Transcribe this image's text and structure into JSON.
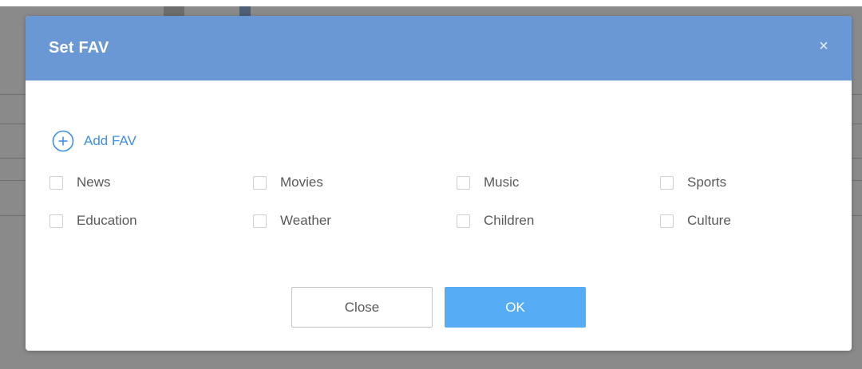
{
  "dialog": {
    "title": "Set FAV",
    "close_icon": "×",
    "accent_color": "#6a98d4"
  },
  "add_fav": {
    "icon": "plus-circle-icon",
    "label": "Add FAV",
    "color": "#3d8fe6"
  },
  "options": [
    {
      "label": "News",
      "checked": false
    },
    {
      "label": "Movies",
      "checked": false
    },
    {
      "label": "Music",
      "checked": false
    },
    {
      "label": "Sports",
      "checked": false
    },
    {
      "label": "Education",
      "checked": false
    },
    {
      "label": "Weather",
      "checked": false
    },
    {
      "label": "Children",
      "checked": false
    },
    {
      "label": "Culture",
      "checked": false
    }
  ],
  "buttons": {
    "close_label": "Close",
    "ok_label": "OK",
    "ok_color": "#56adf5"
  }
}
